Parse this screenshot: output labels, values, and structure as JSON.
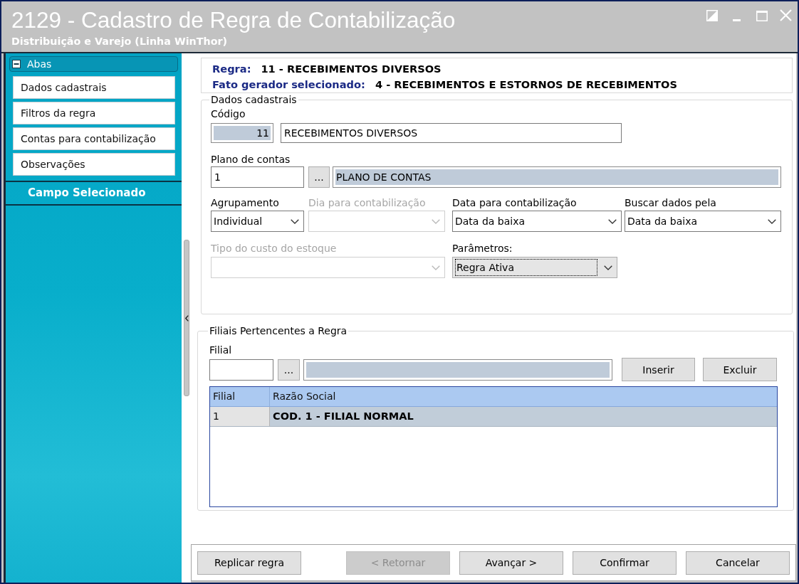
{
  "window": {
    "title": "2129 - Cadastro de Regra de Contabilização",
    "subtitle": "Distribuição e Varejo (Linha WinThor)"
  },
  "sidebar": {
    "group": {
      "label": "Abas",
      "expanded": true
    },
    "items": [
      {
        "label": "Dados cadastrais"
      },
      {
        "label": "Filtros da regra"
      },
      {
        "label": "Contas para contabilização"
      },
      {
        "label": "Observações"
      }
    ],
    "section_title": "Campo Selecionado"
  },
  "rule_info": {
    "rule_label": "Regra:",
    "rule_value": "11 - RECEBIMENTOS DIVERSOS",
    "trigger_label": "Fato gerador selecionado:",
    "trigger_value": "4 - RECEBIMENTOS E ESTORNOS DE RECEBIMENTOS"
  },
  "dados_cadastrais": {
    "title": "Dados cadastrais",
    "codigo": {
      "label": "Código",
      "code": "11",
      "description": "RECEBIMENTOS DIVERSOS"
    },
    "plano_de_contas": {
      "label": "Plano de contas",
      "code": "1",
      "lookup_button": "...",
      "description": "PLANO DE CONTAS"
    },
    "combo_rows": [
      [
        {
          "label": "Agrupamento",
          "value": "Individual",
          "disabled": false,
          "focused": false
        },
        {
          "label": "Dia para contabilização",
          "disabled": true,
          "focused": false
        },
        {
          "label": "Data para contabilização",
          "value": "Data da baixa",
          "disabled": false,
          "focused": false
        },
        {
          "label": "Buscar dados pela",
          "value": "Data da baixa",
          "disabled": false,
          "focused": false
        }
      ],
      [
        {
          "label": "Tipo do custo do estoque",
          "disabled": true,
          "focused": false
        },
        {
          "label": "Parâmetros:",
          "value": "Regra Ativa",
          "disabled": false,
          "focused": true
        }
      ]
    ]
  },
  "filiais": {
    "title": "Filiais Pertencentes a Regra",
    "filial_label": "Filial",
    "lookup_button": "...",
    "buttons": [
      {
        "label": "Inserir"
      },
      {
        "label": "Excluir"
      }
    ],
    "table": {
      "columns": [
        "Filial",
        "Razão Social"
      ],
      "rows": [
        {
          "cells": [
            "1",
            "COD. 1 - FILIAL NORMAL"
          ],
          "selected": true
        }
      ]
    }
  },
  "footer_buttons": [
    {
      "label": "Replicar regra",
      "disabled": false
    },
    {
      "label": "< Retornar",
      "disabled": true
    },
    {
      "label": "Avançar >",
      "disabled": false
    },
    {
      "label": "Confirmar",
      "disabled": false
    },
    {
      "label": "Cancelar",
      "disabled": false
    }
  ]
}
